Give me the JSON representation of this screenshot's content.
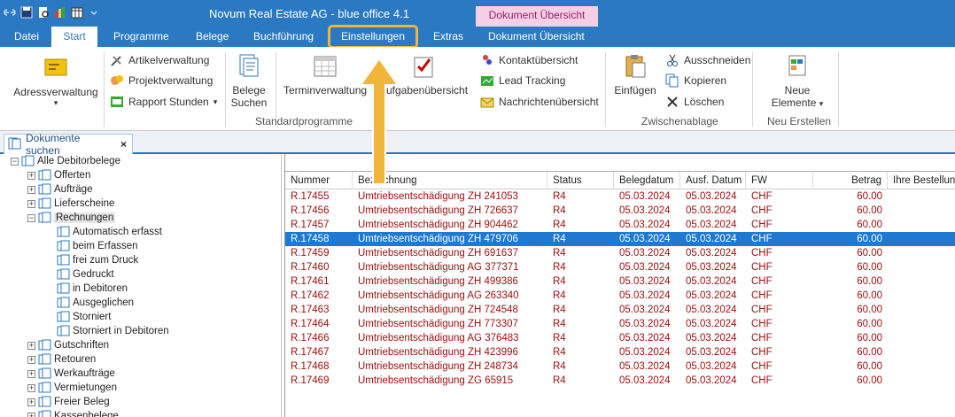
{
  "app": {
    "title": "Novum Real Estate AG - blue office 4.1",
    "context_tab": "Dokument Übersicht"
  },
  "tabs": [
    {
      "label": "Datei"
    },
    {
      "label": "Start"
    },
    {
      "label": "Programme"
    },
    {
      "label": "Belege"
    },
    {
      "label": "Buchführung"
    },
    {
      "label": "Einstellungen"
    },
    {
      "label": "Extras"
    },
    {
      "label": "Dokument Übersicht"
    }
  ],
  "ribbon": {
    "adressverwaltung": "Adressverwaltung",
    "artikelverwaltung": "Artikelverwaltung",
    "projektverwaltung": "Projektverwaltung",
    "rapport_stunden": "Rapport Stunden",
    "belege_suchen_1": "Belege",
    "belege_suchen_2": "Suchen",
    "terminverwaltung": "Terminverwaltung",
    "aufgabenuebersicht": "Aufgabenübersicht",
    "kontaktuebersicht": "Kontaktübersicht",
    "lead_tracking": "Lead Tracking",
    "nachrichtenuebersicht": "Nachrichtenübersicht",
    "einfuegen": "Einfügen",
    "ausschneiden": "Ausschneiden",
    "kopieren": "Kopieren",
    "loeschen": "Löschen",
    "neue_1": "Neue",
    "neue_2": "Elemente",
    "group_standard": "Standardprogramme",
    "group_zwischenablage": "Zwischenablage",
    "group_neu": "Neu Erstellen"
  },
  "doc_tab": {
    "label": "Dokumente suchen",
    "close": "×"
  },
  "tree": {
    "root": "Alle Debitorbelege",
    "items": [
      {
        "label": "Offerten",
        "exp": "+"
      },
      {
        "label": "Aufträge",
        "exp": "+"
      },
      {
        "label": "Lieferscheine",
        "exp": "+"
      },
      {
        "label": "Rechnungen",
        "exp": "−"
      },
      {
        "label": "Automatisch erfasst",
        "exp": ""
      },
      {
        "label": "beim Erfassen",
        "exp": ""
      },
      {
        "label": "frei zum Druck",
        "exp": ""
      },
      {
        "label": "Gedruckt",
        "exp": ""
      },
      {
        "label": "in Debitoren",
        "exp": ""
      },
      {
        "label": "Ausgeglichen",
        "exp": ""
      },
      {
        "label": "Storniert",
        "exp": ""
      },
      {
        "label": "Storniert in Debitoren",
        "exp": ""
      },
      {
        "label": "Gutschriften",
        "exp": "+"
      },
      {
        "label": "Retouren",
        "exp": "+"
      },
      {
        "label": "Werkaufträge",
        "exp": "+"
      },
      {
        "label": "Vermietungen",
        "exp": "+"
      },
      {
        "label": "Freier Beleg",
        "exp": "+"
      },
      {
        "label": "Kassenbelege",
        "exp": "+"
      }
    ]
  },
  "grid": {
    "columns": [
      "Nummer",
      "Bezeichnung",
      "Status",
      "Belegdatum",
      "Ausf. Datum",
      "FW",
      "Betrag",
      "Ihre Bestellung"
    ],
    "rows": [
      [
        "R.17455",
        "Umtriebsentschädigung ZH 241053",
        "R4",
        "05.03.2024",
        "05.03.2024",
        "CHF",
        "60.00"
      ],
      [
        "R.17456",
        "Umtriebsentschädigung ZH 726637",
        "R4",
        "05.03.2024",
        "05.03.2024",
        "CHF",
        "60.00"
      ],
      [
        "R.17457",
        "Umtriebsentschädigung ZH 904462",
        "R4",
        "05.03.2024",
        "05.03.2024",
        "CHF",
        "60.00"
      ],
      [
        "R.17458",
        "Umtriebsentschädigung ZH 479706",
        "R4",
        "05.03.2024",
        "05.03.2024",
        "CHF",
        "60.00"
      ],
      [
        "R.17459",
        "Umtriebsentschädigung ZH 691637",
        "R4",
        "05.03.2024",
        "05.03.2024",
        "CHF",
        "60.00"
      ],
      [
        "R.17460",
        "Umtriebsentschädigung AG 377371",
        "R4",
        "05.03.2024",
        "05.03.2024",
        "CHF",
        "60.00"
      ],
      [
        "R.17461",
        "Umtriebsentschädigung ZH 499386",
        "R4",
        "05.03.2024",
        "05.03.2024",
        "CHF",
        "60.00"
      ],
      [
        "R.17462",
        "Umtriebsentschädigung AG 263340",
        "R4",
        "05.03.2024",
        "05.03.2024",
        "CHF",
        "60.00"
      ],
      [
        "R.17463",
        "Umtriebsentschädigung ZH 724548",
        "R4",
        "05.03.2024",
        "05.03.2024",
        "CHF",
        "60.00"
      ],
      [
        "R.17464",
        "Umtriebsentschädigung ZH 773307",
        "R4",
        "05.03.2024",
        "05.03.2024",
        "CHF",
        "60.00"
      ],
      [
        "R.17466",
        "Umtriebsentschädigung AG 376483",
        "R4",
        "05.03.2024",
        "05.03.2024",
        "CHF",
        "60.00"
      ],
      [
        "R.17467",
        "Umtriebsentschädigung ZH 423996",
        "R4",
        "05.03.2024",
        "05.03.2024",
        "CHF",
        "60.00"
      ],
      [
        "R.17468",
        "Umtriebsentschädigung ZH 248734",
        "R4",
        "05.03.2024",
        "05.03.2024",
        "CHF",
        "60.00"
      ],
      [
        "R.17469",
        "Umtriebsentschädigung ZG 65915",
        "R4",
        "05.03.2024",
        "05.03.2024",
        "CHF",
        "60.00"
      ]
    ],
    "selected_row": 3
  },
  "colors": {
    "accent": "#2b79c2",
    "highlight": "#f0b53a",
    "selection": "#1f78d1",
    "row_text": "#a01010"
  }
}
